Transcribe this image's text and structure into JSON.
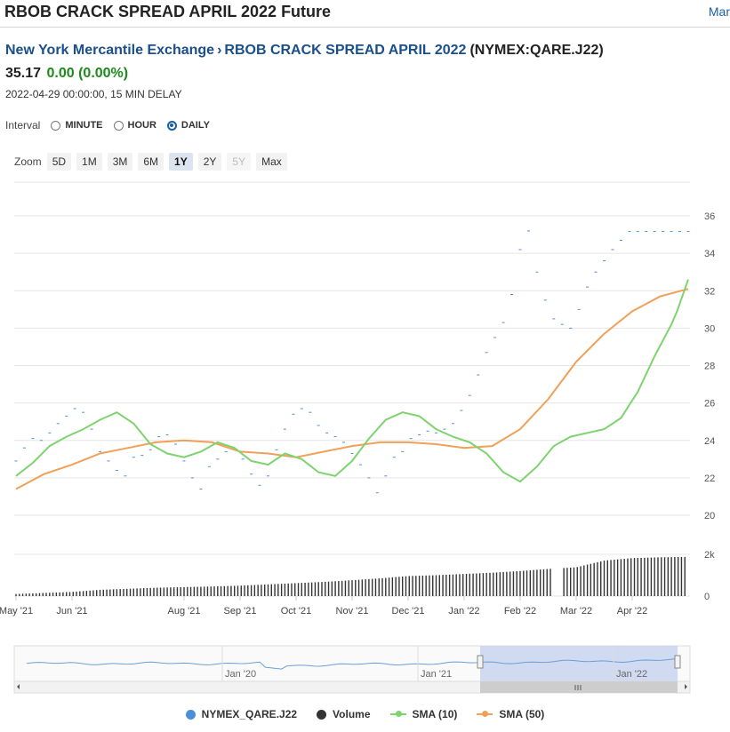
{
  "header": {
    "title": "RBOB CRACK SPREAD APRIL 2022 Future",
    "right_link": "Mar"
  },
  "breadcrumb": {
    "exchange": "New York Mercantile Exchange",
    "separator": "›",
    "instrument": "RBOB CRACK SPREAD APRIL 2022",
    "symbol": "(NYMEX:QARE.J22)"
  },
  "quote": {
    "last": "35.17",
    "change": "0.00 (0.00%)",
    "timestamp": "2022-04-29 00:00:00, 15 MIN DELAY"
  },
  "interval": {
    "label": "Interval",
    "options": [
      "MINUTE",
      "HOUR",
      "DAILY"
    ],
    "selected": "DAILY"
  },
  "zoom": {
    "label": "Zoom",
    "options": [
      "5D",
      "1M",
      "3M",
      "6M",
      "1Y",
      "2Y",
      "5Y",
      "Max"
    ],
    "selected": "1Y",
    "disabled": [
      "5Y"
    ]
  },
  "colors": {
    "price": "#4a90d9",
    "volume": "#333333",
    "sma10": "#7ed36f",
    "sma50": "#f0a058",
    "navigator_fill": "#c8d3ee"
  },
  "legend": [
    {
      "name": "NYMEX_QARE.J22",
      "color": "#4a90d9",
      "kind": "dot"
    },
    {
      "name": "Volume",
      "color": "#333333",
      "kind": "dot"
    },
    {
      "name": "SMA (10)",
      "color": "#7ed36f",
      "kind": "line"
    },
    {
      "name": "SMA (50)",
      "color": "#f0a058",
      "kind": "line"
    }
  ],
  "chart_data": {
    "type": "line",
    "x_ticks": [
      "May '21",
      "Jun '21",
      "Aug '21",
      "Sep '21",
      "Oct '21",
      "Nov '21",
      "Dec '21",
      "Jan '22",
      "Feb '22",
      "Mar '22",
      "Apr '22"
    ],
    "x_tick_month_index": [
      0,
      1,
      3,
      4,
      5,
      6,
      7,
      8,
      9,
      10,
      11
    ],
    "y_ticks": [
      20,
      22,
      24,
      26,
      28,
      30,
      32,
      34,
      36
    ],
    "ylim": [
      20,
      37
    ],
    "volume_ticks": [
      "0",
      "2k"
    ],
    "volume_ylim": [
      0,
      2000
    ],
    "navigator_ticks": [
      "Jan '20",
      "Jan '21",
      "Jan '22"
    ],
    "series": [
      {
        "name": "NYMEX_QARE.J22",
        "style": "points",
        "x": [
          0,
          0.15,
          0.3,
          0.45,
          0.6,
          0.75,
          0.9,
          1.05,
          1.2,
          1.35,
          1.5,
          1.65,
          1.8,
          1.95,
          2.1,
          2.25,
          2.4,
          2.55,
          2.7,
          2.85,
          3,
          3.15,
          3.3,
          3.45,
          3.6,
          3.75,
          3.9,
          4.05,
          4.2,
          4.35,
          4.5,
          4.65,
          4.8,
          4.95,
          5.1,
          5.25,
          5.4,
          5.55,
          5.7,
          5.85,
          6,
          6.15,
          6.3,
          6.45,
          6.6,
          6.75,
          6.9,
          7.05,
          7.2,
          7.35,
          7.5,
          7.65,
          7.8,
          7.95,
          8.1,
          8.25,
          8.4,
          8.55,
          8.7,
          8.85,
          9,
          9.15,
          9.3,
          9.45,
          9.6,
          9.75,
          9.9,
          10.05,
          10.2,
          10.35,
          10.5,
          10.65,
          10.8,
          10.95,
          11.1,
          11.25,
          11.4,
          11.55,
          11.7,
          11.85,
          12
        ],
        "y": [
          22.9,
          23.6,
          24.1,
          24.0,
          24.4,
          24.9,
          25.3,
          25.7,
          25.5,
          24.6,
          23.4,
          22.9,
          22.4,
          22.1,
          23.1,
          23.2,
          23.5,
          24.2,
          24.3,
          23.8,
          22.9,
          22.0,
          21.4,
          22.6,
          23.0,
          23.4,
          23.5,
          23.0,
          22.2,
          21.6,
          22.1,
          23.5,
          24.6,
          25.4,
          25.7,
          25.5,
          24.8,
          24.4,
          24.2,
          23.9,
          23.3,
          22.7,
          22.0,
          21.2,
          22.1,
          23.1,
          23.4,
          24.1,
          24.3,
          24.5,
          24.4,
          24.6,
          24.9,
          25.6,
          26.4,
          27.5,
          28.7,
          29.5,
          30.3,
          31.8,
          34.2,
          35.2,
          33.0,
          31.5,
          30.5,
          30.2,
          30.0,
          31.0,
          32.2,
          33.0,
          33.6,
          34.2,
          34.7,
          35.17,
          35.17,
          35.17,
          35.17,
          35.17,
          35.17,
          35.17,
          35.17
        ]
      },
      {
        "name": "SMA (10)",
        "style": "line",
        "x": [
          0,
          0.3,
          0.6,
          0.9,
          1.2,
          1.5,
          1.8,
          2.1,
          2.4,
          2.7,
          3,
          3.3,
          3.6,
          3.9,
          4.2,
          4.5,
          4.8,
          5.1,
          5.4,
          5.7,
          6,
          6.3,
          6.6,
          6.9,
          7.2,
          7.5,
          7.8,
          8.1,
          8.4,
          8.7,
          9,
          9.3,
          9.6,
          9.9,
          10.2,
          10.5,
          10.8,
          11.1,
          11.4,
          11.7,
          11.8,
          12
        ],
        "y": [
          22.1,
          22.8,
          23.7,
          24.2,
          24.6,
          25.1,
          25.5,
          24.9,
          23.8,
          23.3,
          23.1,
          23.4,
          23.9,
          23.6,
          22.9,
          22.7,
          23.3,
          23.0,
          22.3,
          22.1,
          22.9,
          24.1,
          25.1,
          25.5,
          25.3,
          24.6,
          24.2,
          23.9,
          23.3,
          22.3,
          21.8,
          22.6,
          23.7,
          24.2,
          24.4,
          24.6,
          25.2,
          26.6,
          28.5,
          30.2,
          30.9,
          32.6
        ]
      },
      {
        "name": "SMA (50)",
        "style": "line",
        "x": [
          0,
          0.5,
          1,
          1.5,
          2,
          2.5,
          3,
          3.5,
          4,
          4.5,
          5,
          5.5,
          6,
          6.5,
          7,
          7.5,
          8,
          8.5,
          9,
          9.5,
          10,
          10.5,
          11,
          11.5,
          12
        ],
        "y": [
          21.4,
          22.2,
          22.7,
          23.3,
          23.6,
          23.9,
          24.0,
          23.9,
          23.4,
          23.3,
          23.1,
          23.4,
          23.7,
          23.9,
          23.9,
          23.8,
          23.6,
          23.7,
          24.6,
          26.2,
          28.2,
          29.7,
          30.9,
          31.7,
          32.1
        ]
      },
      {
        "name": "Volume",
        "style": "bars",
        "x": [
          0,
          0.5,
          1,
          1.5,
          2,
          2.5,
          3,
          3.5,
          4,
          4.5,
          5,
          5.5,
          6,
          6.5,
          7,
          7.5,
          8,
          8.5,
          9,
          9.5,
          10,
          10.5,
          11,
          11.5,
          12
        ],
        "y": [
          100,
          150,
          200,
          300,
          350,
          400,
          430,
          460,
          500,
          560,
          620,
          680,
          760,
          850,
          960,
          1000,
          1060,
          1120,
          1200,
          1300,
          1380,
          1700,
          1820,
          1860,
          1880
        ]
      }
    ]
  }
}
